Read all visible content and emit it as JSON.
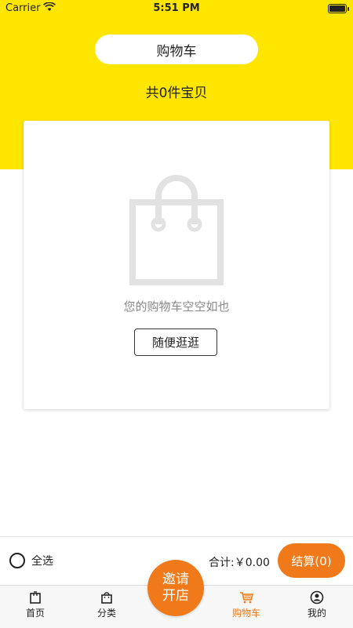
{
  "status_bar": {
    "carrier": "Carrier",
    "time": "5:51 PM"
  },
  "header": {
    "title": "购物车",
    "count_text": "共0件宝贝"
  },
  "empty_state": {
    "message": "您的购物车空空如也",
    "browse_label": "随便逛逛"
  },
  "bottom_bar": {
    "select_all_label": "全选",
    "total_label": "合计:￥0.00",
    "checkout_label": "结算(0)"
  },
  "tab_bar": {
    "tabs": [
      {
        "label": "首页",
        "icon": "home-bag-icon"
      },
      {
        "label": "分类",
        "icon": "category-bag-icon"
      },
      {
        "label": "购物车",
        "icon": "cart-icon"
      },
      {
        "label": "我的",
        "icon": "user-icon"
      }
    ],
    "invite_line1": "邀请",
    "invite_line2": "开店"
  },
  "colors": {
    "header_yellow": "#FFE600",
    "accent_orange": "#F07A1A"
  }
}
